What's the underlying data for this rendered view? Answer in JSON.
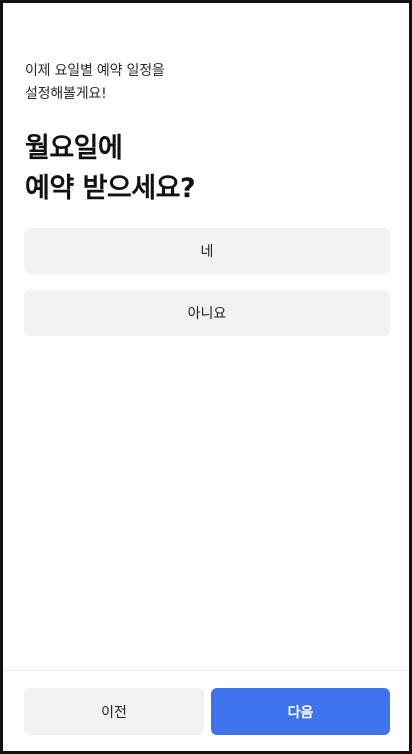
{
  "intro": {
    "line1": "이제 요일별 예약 일정을",
    "line2": "설정해볼게요!"
  },
  "question": {
    "line1": "월요일에",
    "line2": "예약 받으세요?"
  },
  "options": [
    {
      "label": "네"
    },
    {
      "label": "아니요"
    }
  ],
  "navigation": {
    "prev_label": "이전",
    "next_label": "다음"
  },
  "colors": {
    "accent": "#3f73ee",
    "option_bg": "#f2f2f2"
  }
}
